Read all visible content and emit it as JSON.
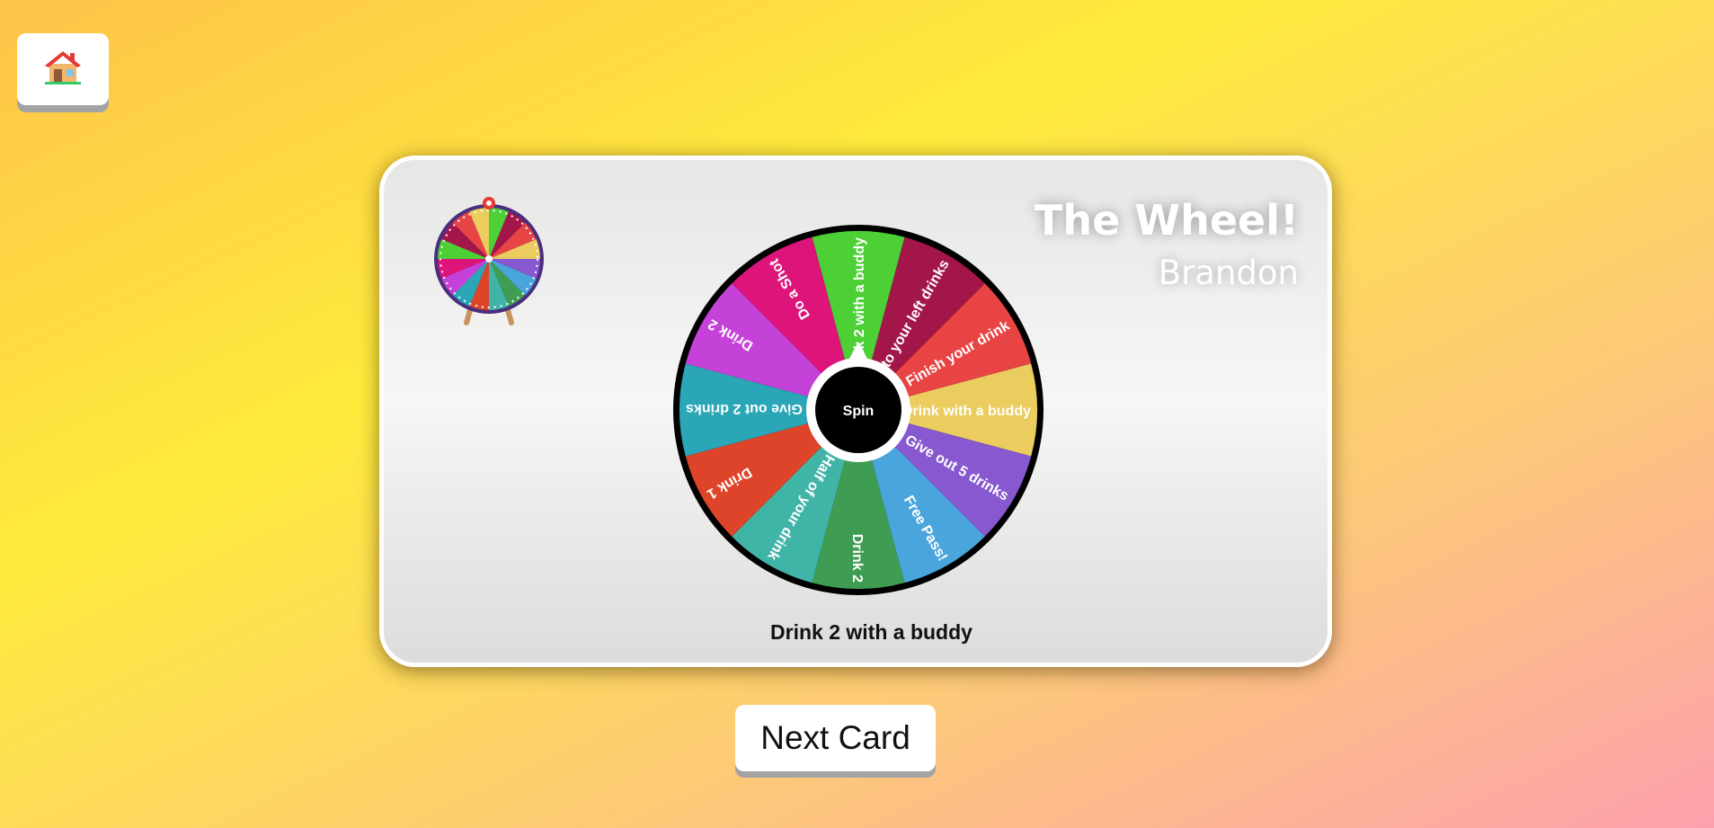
{
  "home": {
    "icon": "house-icon"
  },
  "card": {
    "title": "The Wheel!",
    "player": "Brandon",
    "logo_icon": "wheel-logo-icon",
    "result": "Drink 2 with a buddy"
  },
  "wheel": {
    "spin_label": "Spin",
    "segments": [
      {
        "label": "Drink 2 with a buddy",
        "color": "#4cd036"
      },
      {
        "label": "Player to your left drinks",
        "color": "#a3164a"
      },
      {
        "label": "Finish your drink",
        "color": "#e84444"
      },
      {
        "label": "Drink with a buddy",
        "color": "#ebcc5e"
      },
      {
        "label": "Give out 5 drinks",
        "color": "#8758cf"
      },
      {
        "label": "Free Pass!",
        "color": "#4aa5dc"
      },
      {
        "label": "Drink 2",
        "color": "#3f9d53"
      },
      {
        "label": "Half of your drink",
        "color": "#41b4a8"
      },
      {
        "label": "Drink 1",
        "color": "#de4429"
      },
      {
        "label": "Give out 2 drinks",
        "color": "#2aa6b7"
      },
      {
        "label": "Drink 2",
        "color": "#c542d8"
      },
      {
        "label": "Do a Shot",
        "color": "#dd147a"
      }
    ]
  },
  "next_button": {
    "label": "Next Card"
  }
}
